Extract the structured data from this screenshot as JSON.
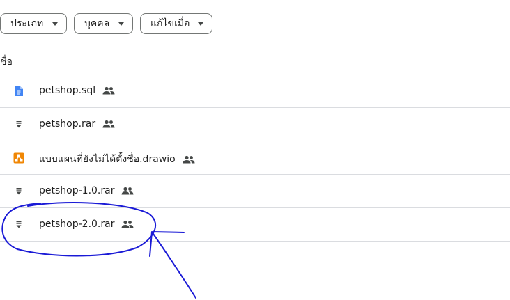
{
  "filters": {
    "type_label": "ประเภท",
    "people_label": "บุคคล",
    "modified_label": "แก้ไขเมื่อ"
  },
  "list": {
    "column_name": "ชื่อ",
    "files": [
      {
        "name": "petshop.sql",
        "icon": "google-docs-icon",
        "shared": true
      },
      {
        "name": "petshop.rar",
        "icon": "archive-file-icon",
        "shared": true
      },
      {
        "name": "แบบแผนที่ยังไม่ได้ตั้งชื่อ.drawio",
        "icon": "drawio-icon",
        "shared": true
      },
      {
        "name": "petshop-1.0.rar",
        "icon": "archive-file-icon",
        "shared": true
      },
      {
        "name": "petshop-2.0.rar",
        "icon": "archive-file-icon",
        "shared": true
      }
    ]
  },
  "colors": {
    "docs_blue": "#4285f4",
    "drawio_orange": "#f08705",
    "annotation_blue": "#1a1ad6"
  }
}
